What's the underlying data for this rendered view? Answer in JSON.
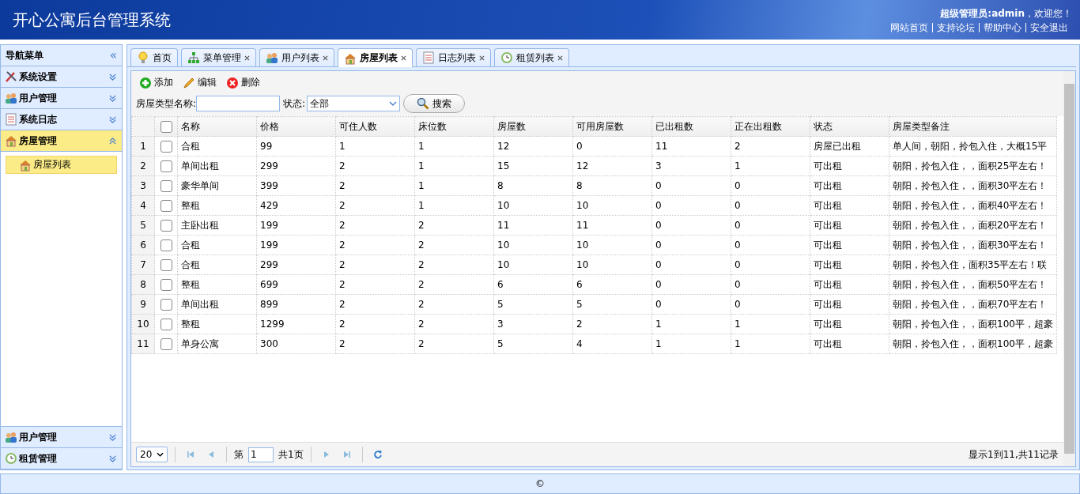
{
  "header": {
    "title": "开心公寓后台管理系统",
    "welcome": "**超级管理员:admin**，欢迎您！",
    "links": [
      "网站首页",
      "支持论坛",
      "帮助中心",
      "安全退出"
    ]
  },
  "sidebar": {
    "title": "导航菜单",
    "collapse_icon": "«",
    "groups": [
      {
        "label": "系统设置",
        "expanded": false,
        "selected": false
      },
      {
        "label": "用户管理",
        "expanded": false,
        "selected": false
      },
      {
        "label": "系统日志",
        "expanded": false,
        "selected": false
      },
      {
        "label": "房屋管理",
        "expanded": true,
        "selected": true,
        "children": [
          {
            "label": "房屋列表",
            "selected": true
          }
        ]
      }
    ],
    "bottom_groups": [
      {
        "label": "用户管理",
        "expanded": false,
        "selected": false
      },
      {
        "label": "租赁管理",
        "expanded": false,
        "selected": false
      }
    ]
  },
  "tabs": [
    {
      "label": "首页",
      "closable": false,
      "selected": false
    },
    {
      "label": "菜单管理",
      "closable": true,
      "selected": false
    },
    {
      "label": "用户列表",
      "closable": true,
      "selected": false
    },
    {
      "label": "房屋列表",
      "closable": true,
      "selected": true
    },
    {
      "label": "日志列表",
      "closable": true,
      "selected": false
    },
    {
      "label": "租赁列表",
      "closable": true,
      "selected": false
    }
  ],
  "toolbar": [
    {
      "label": "添加",
      "kind": "add"
    },
    {
      "label": "编辑",
      "kind": "edit"
    },
    {
      "label": "删除",
      "kind": "delete"
    }
  ],
  "search": {
    "name_label": "房屋类型名称:",
    "status_label": "状态:",
    "status_value": "全部",
    "button": "搜索"
  },
  "table": {
    "all_checked": false,
    "columns": [
      "名称",
      "价格",
      "可住人数",
      "床位数",
      "房屋数",
      "可用房屋数",
      "已出租数",
      "正在出租数",
      "状态",
      "房屋类型备注"
    ],
    "rows": [
      {
        "number": "1",
        "checked": false,
        "cells": [
          "合租",
          "99",
          "1",
          "1",
          "12",
          "0",
          "11",
          "2",
          "房屋已出租",
          "单人间，朝阳，拎包入住，大概15平"
        ]
      },
      {
        "number": "2",
        "checked": false,
        "cells": [
          "单间出租",
          "299",
          "2",
          "1",
          "15",
          "12",
          "3",
          "1",
          "可出租",
          "朝阳，拎包入住，，面积25平左右！"
        ]
      },
      {
        "number": "3",
        "checked": false,
        "cells": [
          "豪华单间",
          "399",
          "2",
          "1",
          "8",
          "8",
          "0",
          "0",
          "可出租",
          "朝阳，拎包入住，，面积30平左右！"
        ]
      },
      {
        "number": "4",
        "checked": false,
        "cells": [
          "整租",
          "429",
          "2",
          "1",
          "10",
          "10",
          "0",
          "0",
          "可出租",
          "朝阳，拎包入住，，面积40平左右！"
        ]
      },
      {
        "number": "5",
        "checked": false,
        "cells": [
          "主卧出租",
          "199",
          "2",
          "2",
          "11",
          "11",
          "0",
          "0",
          "可出租",
          "朝阳，拎包入住，，面积20平左右！"
        ]
      },
      {
        "number": "6",
        "checked": false,
        "cells": [
          "合租",
          "199",
          "2",
          "2",
          "10",
          "10",
          "0",
          "0",
          "可出租",
          "朝阳，拎包入住，，面积30平左右！"
        ]
      },
      {
        "number": "7",
        "checked": false,
        "cells": [
          "合租",
          "299",
          "2",
          "2",
          "10",
          "10",
          "0",
          "0",
          "可出租",
          "朝阳，拎包入住，面积35平左右！联"
        ]
      },
      {
        "number": "8",
        "checked": false,
        "cells": [
          "整租",
          "699",
          "2",
          "2",
          "6",
          "6",
          "0",
          "0",
          "可出租",
          "朝阳，拎包入住，，面积50平左右！"
        ]
      },
      {
        "number": "9",
        "checked": false,
        "cells": [
          "单间出租",
          "899",
          "2",
          "2",
          "5",
          "5",
          "0",
          "0",
          "可出租",
          "朝阳，拎包入住，，面积70平左右！"
        ]
      },
      {
        "number": "10",
        "checked": false,
        "cells": [
          "整租",
          "1299",
          "2",
          "2",
          "3",
          "2",
          "1",
          "1",
          "可出租",
          "朝阳，拎包入住，，面积100平，超豪"
        ]
      },
      {
        "number": "11",
        "checked": false,
        "cells": [
          "单身公寓",
          "300",
          "2",
          "2",
          "5",
          "4",
          "1",
          "1",
          "可出租",
          "朝阳，拎包入住，，面积100平，超豪"
        ]
      }
    ]
  },
  "pager": {
    "page_size": "20",
    "page_prefix": "第",
    "page": "1",
    "page_total": "共1页",
    "summary": "显示1到11,共11记录"
  },
  "footer": {
    "text": "©"
  }
}
